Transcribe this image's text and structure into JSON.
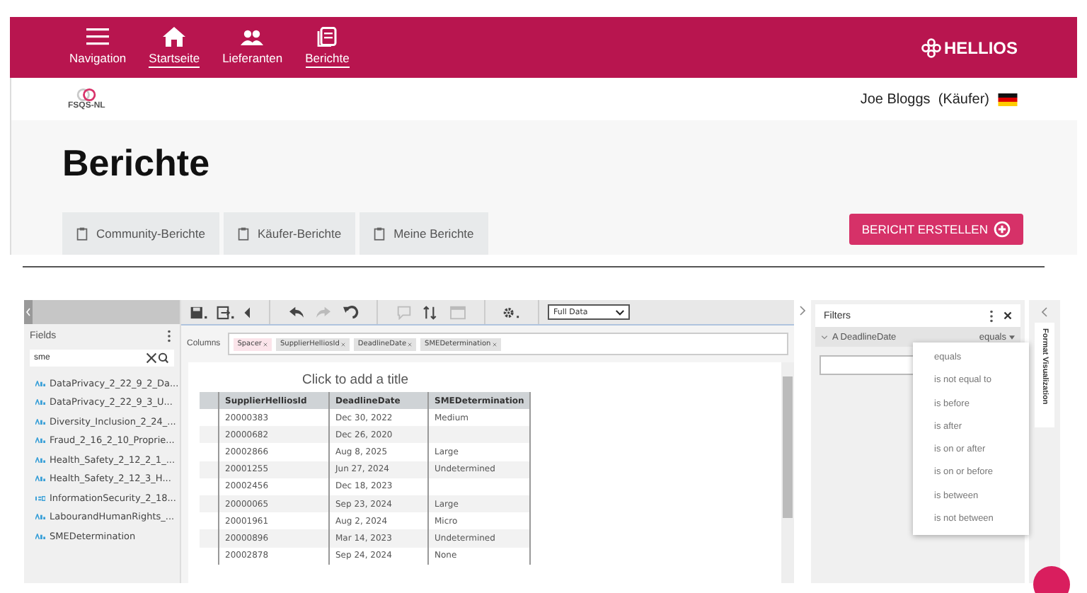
{
  "nav": {
    "items": [
      {
        "label": "Navigation",
        "active": false
      },
      {
        "label": "Startseite",
        "active": true
      },
      {
        "label": "Lieferanten",
        "active": false
      },
      {
        "label": "Berichte",
        "active": true
      }
    ],
    "brand": "HELLIOS"
  },
  "user_bar": {
    "org": "FSQS-NL",
    "user": "Joe Bloggs  (Käufer)"
  },
  "page": {
    "title": "Berichte",
    "tabs": [
      "Community-Berichte",
      "Käufer-Berichte",
      "Meine Berichte"
    ],
    "create_button": "BERICHT ERSTELLEN"
  },
  "fields_panel": {
    "title": "Fields",
    "search_value": "sme",
    "fields": [
      {
        "kind": "text",
        "name": "DataPrivacy_2_22_9_2_Da..."
      },
      {
        "kind": "text",
        "name": "DataPrivacy_2_22_9_3_U..."
      },
      {
        "kind": "text",
        "name": "Diversity_Inclusion_2_24_..."
      },
      {
        "kind": "text",
        "name": "Fraud_2_16_2_10_Proprie..."
      },
      {
        "kind": "text",
        "name": "Health_Safety_2_12_2_1_..."
      },
      {
        "kind": "text",
        "name": "Health_Safety_2_12_3_H..."
      },
      {
        "kind": "number",
        "name": "InformationSecurity_2_18..."
      },
      {
        "kind": "text",
        "name": "LabourandHumanRights_..."
      },
      {
        "kind": "text",
        "name": "SMEDetermination"
      }
    ]
  },
  "toolbar": {
    "view_select": "Full Data"
  },
  "columns_bar": {
    "label": "Columns",
    "chips": [
      {
        "kind": "spacer",
        "label": "Spacer"
      },
      {
        "kind": "field",
        "label": "SupplierHelliosId"
      },
      {
        "kind": "field",
        "label": "DeadlineDate"
      },
      {
        "kind": "field",
        "label": "SMEDetermination"
      }
    ]
  },
  "table": {
    "title_placeholder": "Click to add a title",
    "columns": [
      "SupplierHelliosId",
      "DeadlineDate",
      "SMEDetermination"
    ],
    "rows": [
      [
        "20000383",
        "Dec 30, 2022",
        "Medium"
      ],
      [
        "20000682",
        "Dec 26, 2020",
        ""
      ],
      [
        "20002866",
        "Aug 8, 2025",
        "Large"
      ],
      [
        "20001255",
        "Jun 27, 2024",
        "Undetermined"
      ],
      [
        "20002456",
        "Dec 18, 2023",
        ""
      ],
      [
        "20000065",
        "Sep 23, 2024",
        "Large"
      ],
      [
        "20001961",
        "Aug 2, 2024",
        "Micro"
      ],
      [
        "20000896",
        "Mar 14, 2023",
        "Undetermined"
      ],
      [
        "20002878",
        "Sep 24, 2024",
        "None"
      ]
    ]
  },
  "filters_panel": {
    "title": "Filters",
    "filter": {
      "field": "A DeadlineDate",
      "operator": "equals"
    },
    "operator_menu": [
      "equals",
      "is not equal to",
      "is before",
      "is after",
      "is on or after",
      "is on or before",
      "is between",
      "is not between"
    ]
  },
  "format_tab": "Format Visualization"
}
